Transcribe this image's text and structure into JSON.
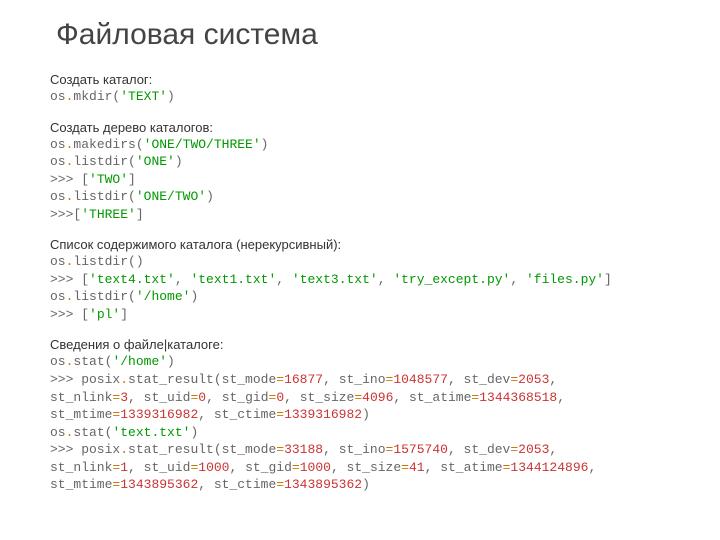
{
  "title": "Файловая система",
  "sections": {
    "mkdir": {
      "heading": "Создать каталог:",
      "code_html": "<span class='p'>os</span><span class='m'>.</span><span class='p'>mkdir(</span><span class='s'>'TEXT'</span><span class='p'>)</span>"
    },
    "makedirs": {
      "heading": "Создать дерево каталогов:",
      "code_html": "<span class='p'>os</span><span class='m'>.</span><span class='p'>makedirs(</span><span class='s'>'ONE/TWO/THREE'</span><span class='p'>)</span>\n<span class='p'>os</span><span class='m'>.</span><span class='p'>listdir(</span><span class='s'>'ONE'</span><span class='p'>)</span>\n<span class='p'>&gt;&gt;&gt; [</span><span class='s'>'TWO'</span><span class='p'>]</span>\n<span class='p'>os</span><span class='m'>.</span><span class='p'>listdir(</span><span class='s'>'ONE/TWO'</span><span class='p'>)</span>\n<span class='p'>&gt;&gt;&gt;[</span><span class='s'>'THREE'</span><span class='p'>]</span>"
    },
    "listdir": {
      "heading": "Список содержимого каталога (нерекурсивный):",
      "code_html": "<span class='p'>os</span><span class='m'>.</span><span class='p'>listdir()</span>\n<span class='p'>&gt;&gt;&gt; [</span><span class='s'>'text4.txt'</span><span class='p'>, </span><span class='s'>'text1.txt'</span><span class='p'>, </span><span class='s'>'text3.txt'</span><span class='p'>, </span><span class='s'>'try_except.py'</span><span class='p'>, </span><span class='s'>'files.py'</span><span class='p'>]</span>\n<span class='p'>os</span><span class='m'>.</span><span class='p'>listdir(</span><span class='s'>'/home'</span><span class='p'>)</span>\n<span class='p'>&gt;&gt;&gt; [</span><span class='s'>'pl'</span><span class='p'>]</span>"
    },
    "stat": {
      "heading": "Сведения о файле|каталоге:",
      "code_html": "<span class='p'>os</span><span class='m'>.</span><span class='p'>stat(</span><span class='s'>'/home'</span><span class='p'>)</span>\n<span class='p'>&gt;&gt;&gt; posix</span><span class='m'>.</span><span class='p'>stat_result(st_mode</span><span class='m'>=</span><span class='n'>16877</span><span class='p'>, st_ino</span><span class='m'>=</span><span class='n'>1048577</span><span class='p'>, st_dev</span><span class='m'>=</span><span class='n'>2053</span><span class='p'>,</span>\n<span class='p'>st_nlink</span><span class='m'>=</span><span class='n'>3</span><span class='p'>, st_uid</span><span class='m'>=</span><span class='n'>0</span><span class='p'>, st_gid</span><span class='m'>=</span><span class='n'>0</span><span class='p'>, st_size</span><span class='m'>=</span><span class='n'>4096</span><span class='p'>, st_atime</span><span class='m'>=</span><span class='n'>1344368518</span><span class='p'>,</span>\n<span class='p'>st_mtime</span><span class='m'>=</span><span class='n'>1339316982</span><span class='p'>, st_ctime</span><span class='m'>=</span><span class='n'>1339316982</span><span class='p'>)</span>\n<span class='p'>os</span><span class='m'>.</span><span class='p'>stat(</span><span class='s'>'text.txt'</span><span class='p'>)</span>\n<span class='p'>&gt;&gt;&gt; posix</span><span class='m'>.</span><span class='p'>stat_result(st_mode</span><span class='m'>=</span><span class='n'>33188</span><span class='p'>, st_ino</span><span class='m'>=</span><span class='n'>1575740</span><span class='p'>, st_dev</span><span class='m'>=</span><span class='n'>2053</span><span class='p'>,</span>\n<span class='p'>st_nlink</span><span class='m'>=</span><span class='n'>1</span><span class='p'>, st_uid</span><span class='m'>=</span><span class='n'>1000</span><span class='p'>, st_gid</span><span class='m'>=</span><span class='n'>1000</span><span class='p'>, st_size</span><span class='m'>=</span><span class='n'>41</span><span class='p'>, st_atime</span><span class='m'>=</span><span class='n'>1344124896</span><span class='p'>,</span>\n<span class='p'>st_mtime</span><span class='m'>=</span><span class='n'>1343895362</span><span class='p'>, st_ctime</span><span class='m'>=</span><span class='n'>1343895362</span><span class='p'>)</span>"
    }
  }
}
